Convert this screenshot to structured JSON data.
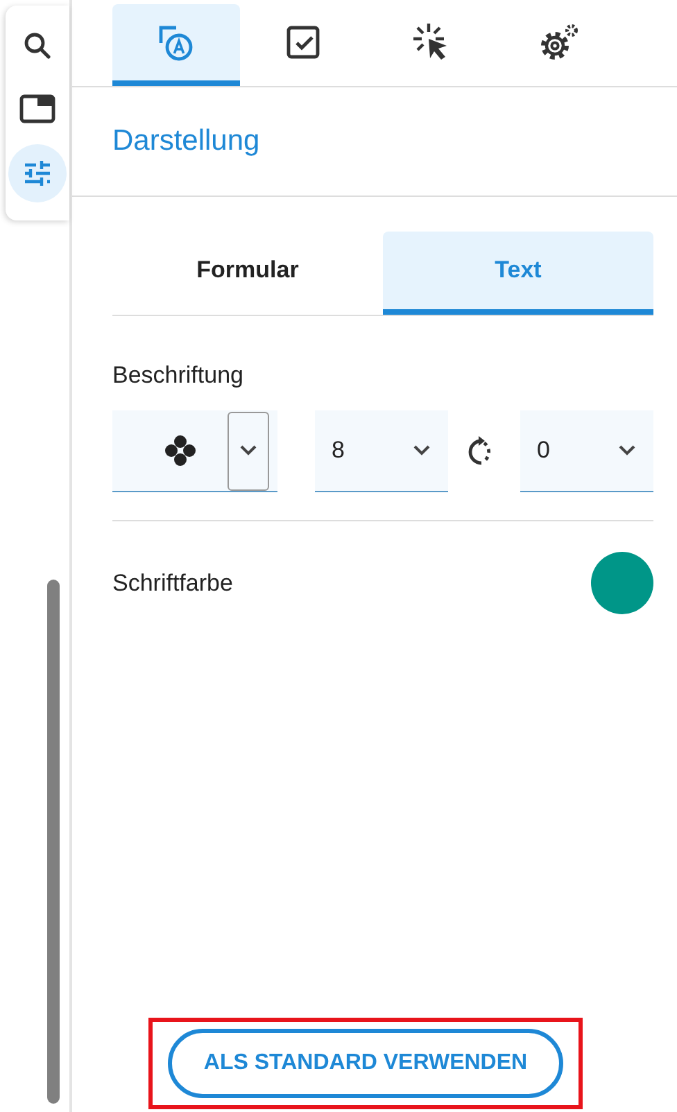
{
  "sidebar": {
    "items": [
      {
        "selected": false
      },
      {
        "selected": false
      },
      {
        "selected": true
      }
    ]
  },
  "icon_tabs": [
    {
      "selected": true
    },
    {
      "selected": false
    },
    {
      "selected": false
    },
    {
      "selected": false
    }
  ],
  "heading": "Darstellung",
  "sub_tabs": [
    {
      "label": "Formular",
      "selected": false
    },
    {
      "label": "Text",
      "selected": true
    }
  ],
  "labeling": {
    "label": "Beschriftung",
    "size": "8",
    "rotation": "0"
  },
  "font_color": {
    "label": "Schriftfarbe",
    "color": "#009688"
  },
  "default_button": {
    "label": "ALS STANDARD VERWENDEN",
    "highlighted": true
  }
}
